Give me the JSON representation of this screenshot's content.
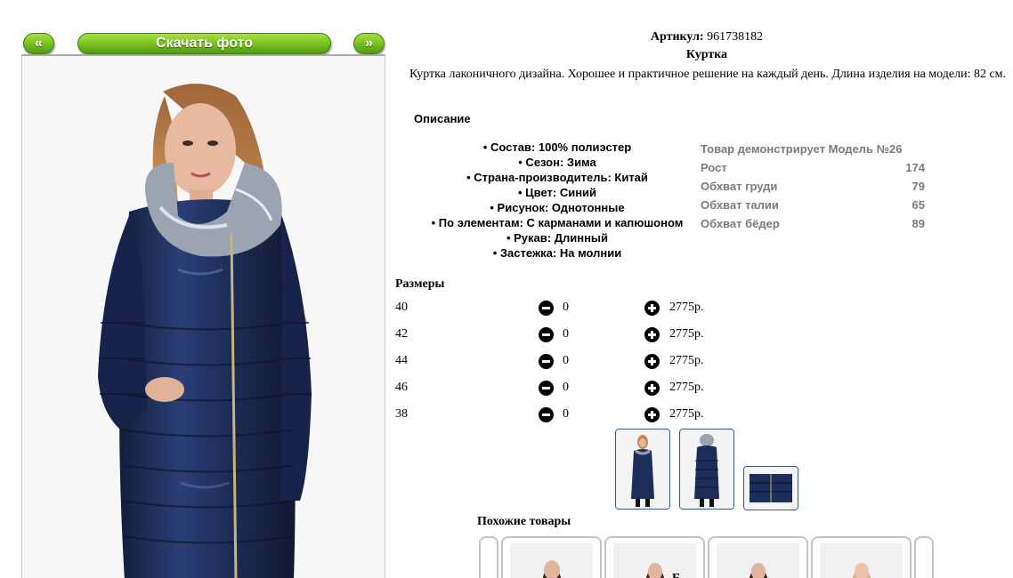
{
  "nav": {
    "prev_label": "«",
    "download_label": "Скачать фото",
    "next_label": "»"
  },
  "product": {
    "sku_label": "Артикул:",
    "sku_value": "961738182",
    "name": "Куртка",
    "description": "Куртка лаконичного дизайна. Хорошее и практичное решение на каждый день. Длина изделия на модели: 82 см.",
    "description_heading": "Описание",
    "features": [
      "• Состав: 100% полиэстер",
      "• Сезон: Зима",
      "• Страна-производитель: Китай",
      "• Цвет: Синий",
      "• Рисунок: Однотонные",
      "• По элементам: С карманами и капюшоном",
      "• Рукав: Длинный",
      "• Застежка: На молнии"
    ]
  },
  "model": {
    "title": "Товар демонстрирует Модель №26",
    "params": [
      {
        "label": "Рост",
        "value": "174"
      },
      {
        "label": "Обхват груди",
        "value": "79"
      },
      {
        "label": "Обхват талии",
        "value": "65"
      },
      {
        "label": "Обхват бёдер",
        "value": "89"
      }
    ]
  },
  "sizes": {
    "heading": "Размеры",
    "rows": [
      {
        "size": "40",
        "qty": "0",
        "price": "2775р."
      },
      {
        "size": "42",
        "qty": "0",
        "price": "2775р."
      },
      {
        "size": "44",
        "qty": "0",
        "price": "2775р."
      },
      {
        "size": "46",
        "qty": "0",
        "price": "2775р."
      },
      {
        "size": "38",
        "qty": "0",
        "price": "2775р."
      }
    ]
  },
  "similar": {
    "heading": "Похожие товары",
    "partial_text": "Б"
  },
  "colors": {
    "accent_green": "#7fc521",
    "jacket_navy": "#1c2c52",
    "muted_gray": "#7b7b7b"
  }
}
